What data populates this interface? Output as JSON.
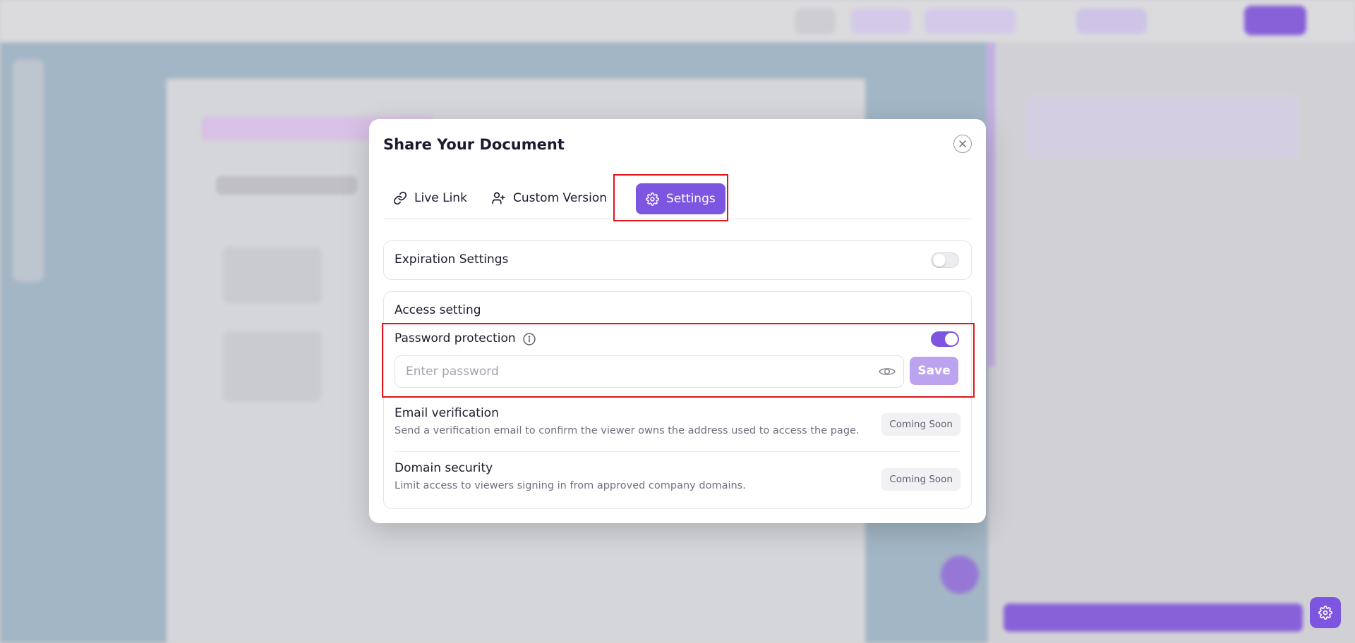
{
  "modal": {
    "title": "Share Your Document",
    "close_icon": "close-icon"
  },
  "tabs": [
    {
      "label": "Live Link",
      "icon": "link-icon",
      "active": false
    },
    {
      "label": "Custom Version",
      "icon": "user-plus-icon",
      "active": false
    },
    {
      "label": "Settings",
      "icon": "gear-icon",
      "active": true
    }
  ],
  "expiration": {
    "label": "Expiration Settings",
    "enabled": false
  },
  "access": {
    "heading": "Access setting",
    "password": {
      "label": "Password protection",
      "info_icon": "info-icon",
      "enabled": true,
      "placeholder": "Enter password",
      "value": "",
      "eye_icon": "eye-icon",
      "save_label": "Save"
    },
    "email": {
      "label": "Email verification",
      "description": "Send a verification email to confirm the viewer owns the address used to access the page.",
      "badge": "Coming Soon"
    },
    "domain": {
      "label": "Domain security",
      "description": "Limit access to viewers signing in from approved company domains.",
      "badge": "Coming Soon"
    }
  },
  "colors": {
    "accent": "#7c55e0",
    "highlight": "#e3151b",
    "save_disabled": "#bba3ef"
  },
  "floating_button": {
    "icon": "gear-icon"
  }
}
